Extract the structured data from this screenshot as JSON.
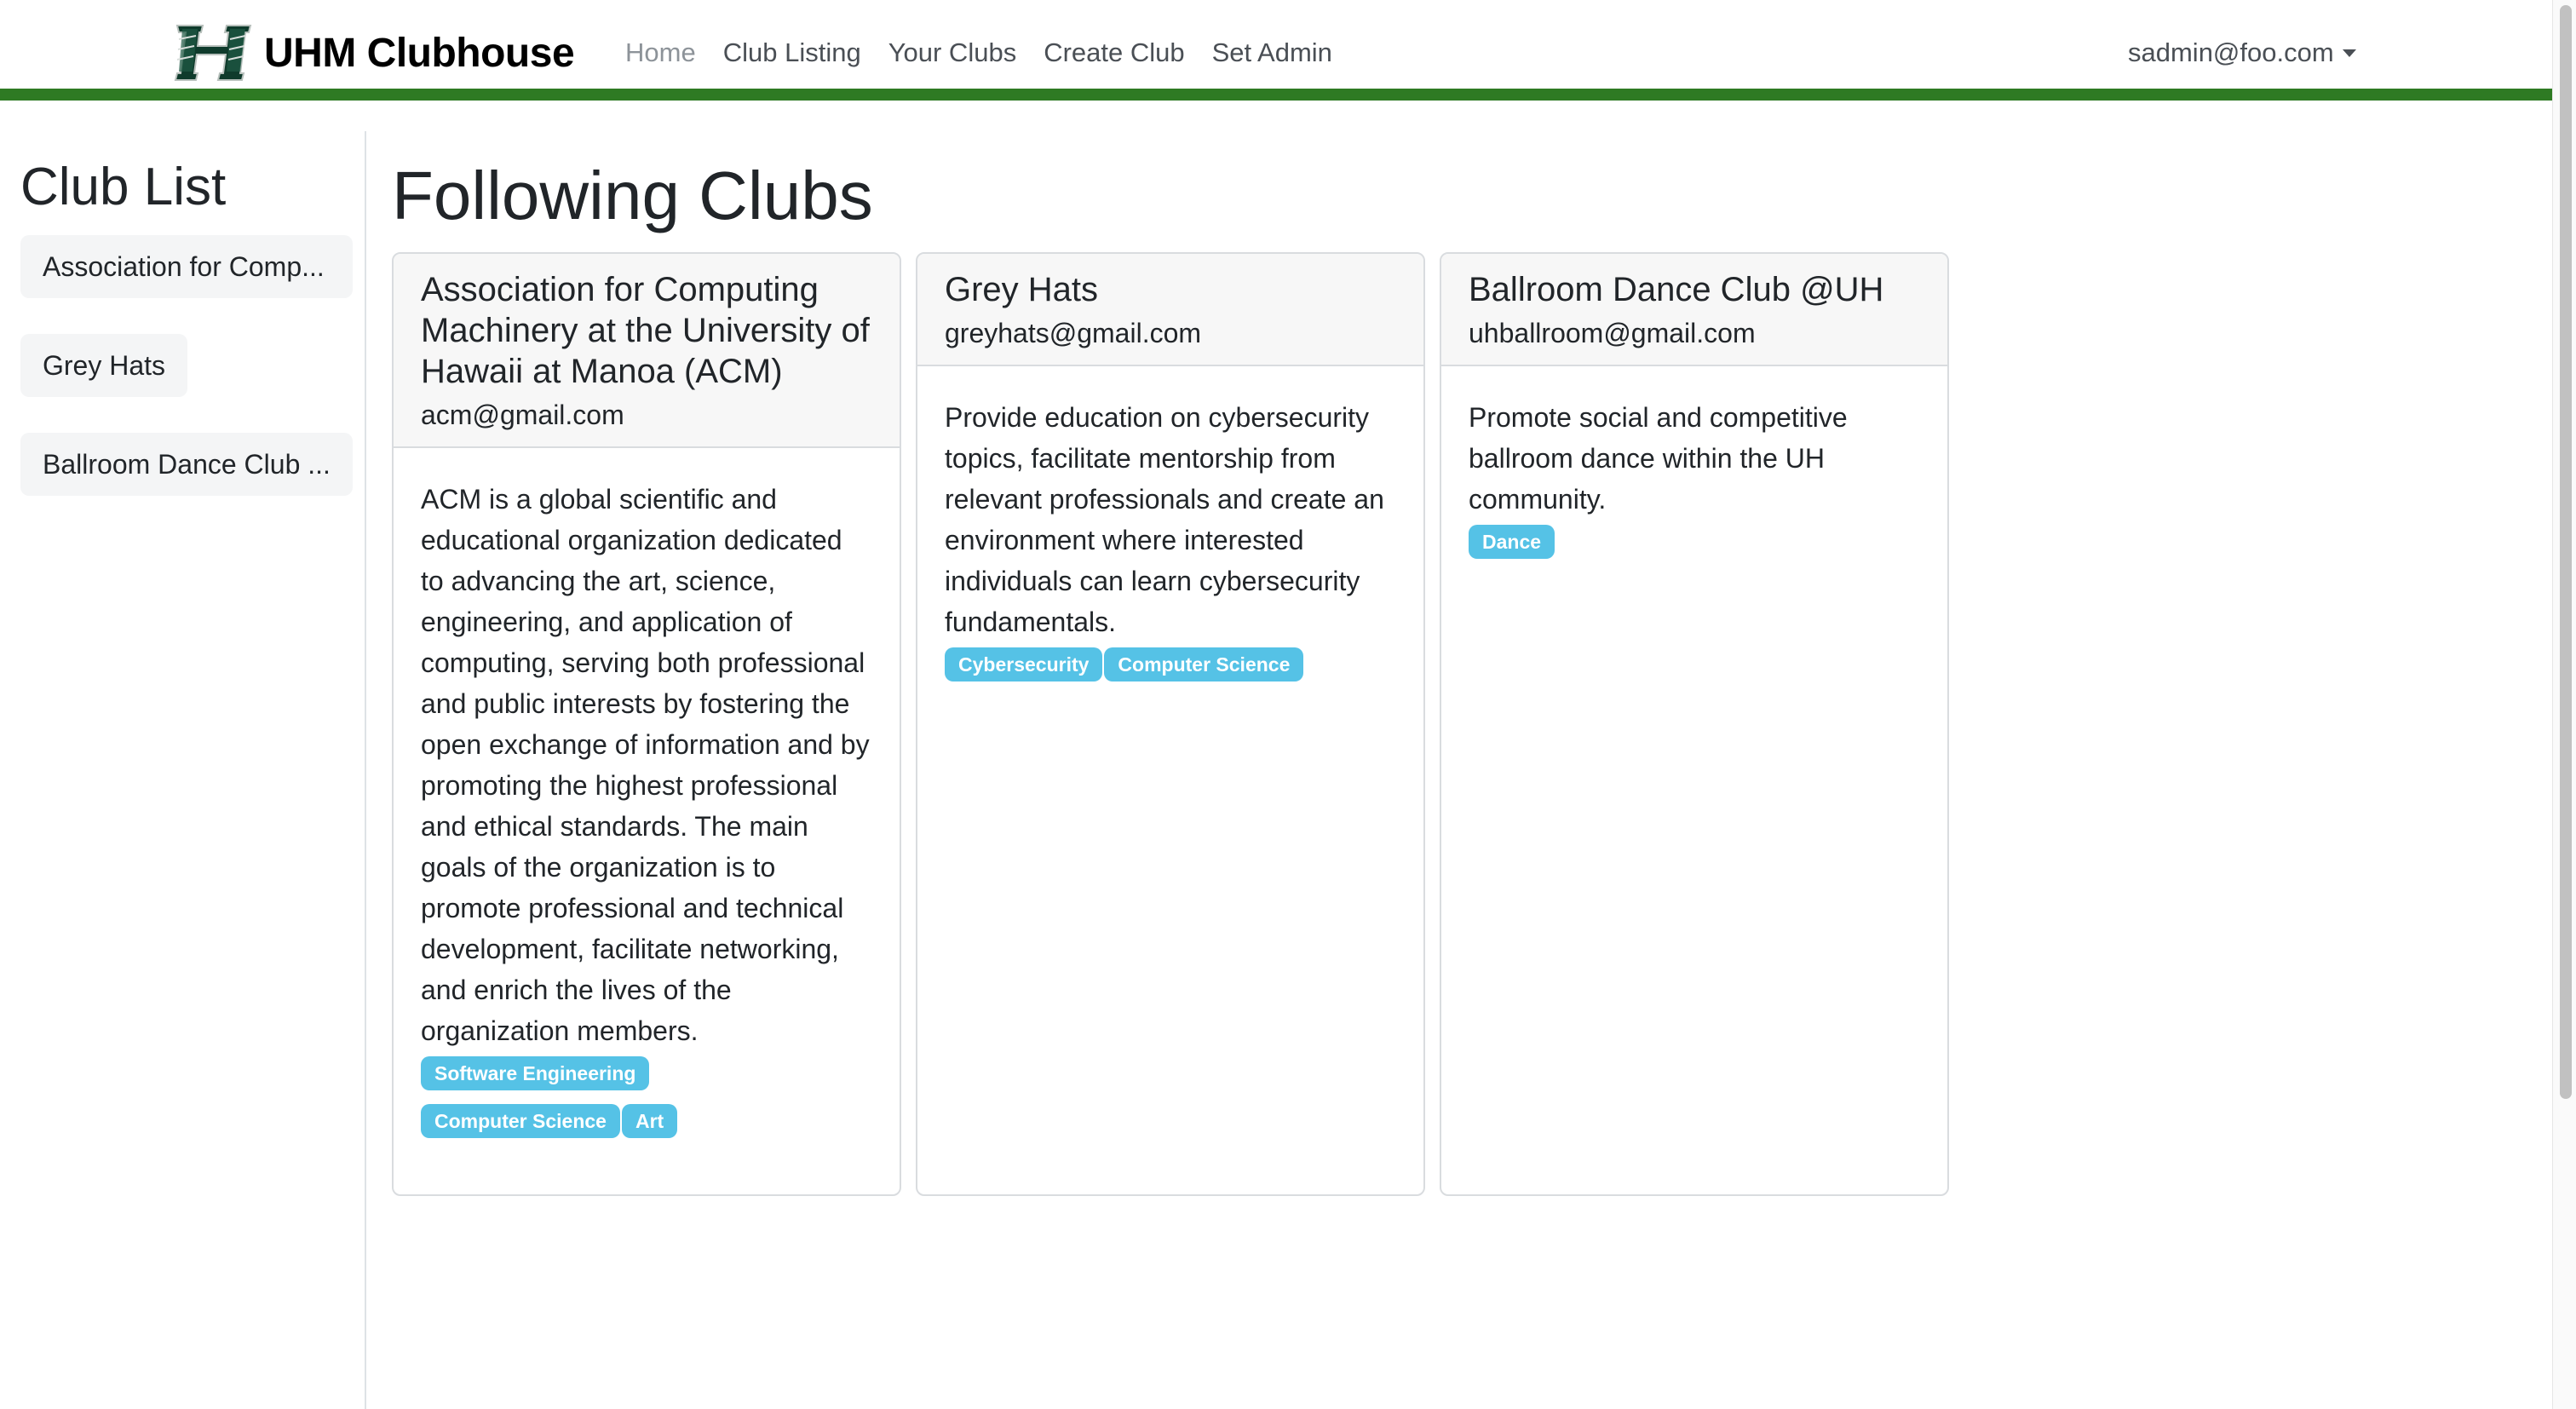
{
  "navbar": {
    "brand": "UHM Clubhouse",
    "links": [
      "Home",
      "Club Listing",
      "Your Clubs",
      "Create Club",
      "Set Admin"
    ],
    "user": "sadmin@foo.com",
    "accent_color": "#2e7a23"
  },
  "sidebar": {
    "title": "Club List",
    "items": [
      {
        "label": "Association for Comp..."
      },
      {
        "label": "Grey Hats"
      },
      {
        "label": "Ballroom Dance Club ..."
      }
    ]
  },
  "main": {
    "title": "Following Clubs",
    "cards": [
      {
        "title": "Association for Computing Machinery at the University of Hawaii at Manoa (ACM)",
        "email": "acm@gmail.com",
        "description": "ACM is a global scientific and educational organization dedicated to advancing the art, science, engineering, and application of computing, serving both professional and public interests by fostering the open exchange of information and by promoting the highest professional and ethical standards. The main goals of the organization is to promote professional and technical development, facilitate networking, and enrich the lives of the organization members.",
        "tags": [
          "Software Engineering",
          "Computer Science",
          "Art"
        ]
      },
      {
        "title": "Grey Hats",
        "email": "greyhats@gmail.com",
        "description": "Provide education on cybersecurity topics, facilitate mentorship from relevant professionals and create an environment where interested individuals can learn cybersecurity fundamentals.",
        "tags": [
          "Cybersecurity",
          "Computer Science"
        ]
      },
      {
        "title": "Ballroom Dance Club @UH",
        "email": "uhballroom@gmail.com",
        "description": "Promote social and competitive ballroom dance within the UH community.",
        "tags": [
          "Dance"
        ]
      }
    ],
    "tag_color": "#55c2e6"
  }
}
